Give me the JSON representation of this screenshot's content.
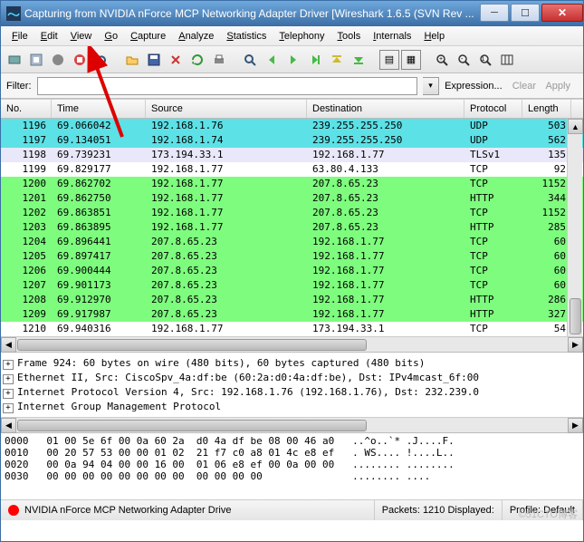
{
  "title": "Capturing from NVIDIA nForce MCP Networking Adapter Driver   [Wireshark 1.6.5  (SVN Rev ...",
  "menu": [
    "File",
    "Edit",
    "View",
    "Go",
    "Capture",
    "Analyze",
    "Statistics",
    "Telephony",
    "Tools",
    "Internals",
    "Help"
  ],
  "filter": {
    "label": "Filter:",
    "value": "",
    "expression": "Expression...",
    "clear": "Clear",
    "apply": "Apply"
  },
  "columns": [
    "No.",
    "Time",
    "Source",
    "Destination",
    "Protocol",
    "Length"
  ],
  "rows": [
    {
      "no": "1196",
      "time": "69.066042",
      "src": "192.168.1.76",
      "dst": "239.255.255.250",
      "proto": "UDP",
      "len": "503",
      "cls": "cyan"
    },
    {
      "no": "1197",
      "time": "69.134051",
      "src": "192.168.1.74",
      "dst": "239.255.255.250",
      "proto": "UDP",
      "len": "562",
      "cls": "cyan"
    },
    {
      "no": "1198",
      "time": "69.739231",
      "src": "173.194.33.1",
      "dst": "192.168.1.77",
      "proto": "TLSv1",
      "len": "135",
      "cls": "lav"
    },
    {
      "no": "1199",
      "time": "69.829177",
      "src": "192.168.1.77",
      "dst": "63.80.4.133",
      "proto": "TCP",
      "len": "92",
      "cls": "white"
    },
    {
      "no": "1200",
      "time": "69.862702",
      "src": "192.168.1.77",
      "dst": "207.8.65.23",
      "proto": "TCP",
      "len": "1152",
      "cls": "green"
    },
    {
      "no": "1201",
      "time": "69.862750",
      "src": "192.168.1.77",
      "dst": "207.8.65.23",
      "proto": "HTTP",
      "len": "344",
      "cls": "green"
    },
    {
      "no": "1202",
      "time": "69.863851",
      "src": "192.168.1.77",
      "dst": "207.8.65.23",
      "proto": "TCP",
      "len": "1152",
      "cls": "green"
    },
    {
      "no": "1203",
      "time": "69.863895",
      "src": "192.168.1.77",
      "dst": "207.8.65.23",
      "proto": "HTTP",
      "len": "285",
      "cls": "green"
    },
    {
      "no": "1204",
      "time": "69.896441",
      "src": "207.8.65.23",
      "dst": "192.168.1.77",
      "proto": "TCP",
      "len": "60",
      "cls": "green"
    },
    {
      "no": "1205",
      "time": "69.897417",
      "src": "207.8.65.23",
      "dst": "192.168.1.77",
      "proto": "TCP",
      "len": "60",
      "cls": "green"
    },
    {
      "no": "1206",
      "time": "69.900444",
      "src": "207.8.65.23",
      "dst": "192.168.1.77",
      "proto": "TCP",
      "len": "60",
      "cls": "green"
    },
    {
      "no": "1207",
      "time": "69.901173",
      "src": "207.8.65.23",
      "dst": "192.168.1.77",
      "proto": "TCP",
      "len": "60",
      "cls": "green"
    },
    {
      "no": "1208",
      "time": "69.912970",
      "src": "207.8.65.23",
      "dst": "192.168.1.77",
      "proto": "HTTP",
      "len": "286",
      "cls": "green"
    },
    {
      "no": "1209",
      "time": "69.917987",
      "src": "207.8.65.23",
      "dst": "192.168.1.77",
      "proto": "HTTP",
      "len": "327",
      "cls": "green"
    },
    {
      "no": "1210",
      "time": "69.940316",
      "src": "192.168.1.77",
      "dst": "173.194.33.1",
      "proto": "TCP",
      "len": "54",
      "cls": "white"
    }
  ],
  "details": [
    "Frame 924: 60 bytes on wire (480 bits), 60 bytes captured (480 bits)",
    "Ethernet II, Src: CiscoSpv_4a:df:be (60:2a:d0:4a:df:be), Dst: IPv4mcast_6f:00",
    "Internet Protocol Version 4, Src: 192.168.1.76 (192.168.1.76), Dst: 232.239.0",
    "Internet Group Management Protocol"
  ],
  "hex": [
    "0000   01 00 5e 6f 00 0a 60 2a  d0 4a df be 08 00 46 a0   ..^o..`* .J....F.",
    "0010   00 20 57 53 00 00 01 02  21 f7 c0 a8 01 4c e8 ef   . WS.... !....L..",
    "0020   00 0a 94 04 00 00 16 00  01 06 e8 ef 00 0a 00 00   ........ ........",
    "0030   00 00 00 00 00 00 00 00  00 00 00 00               ........ ...."
  ],
  "status": {
    "iface": "NVIDIA nForce MCP Networking Adapter Drive",
    "packets": "Packets: 1210 Displayed:",
    "profile": "Profile: Default"
  },
  "watermark": "©51CTO博客"
}
